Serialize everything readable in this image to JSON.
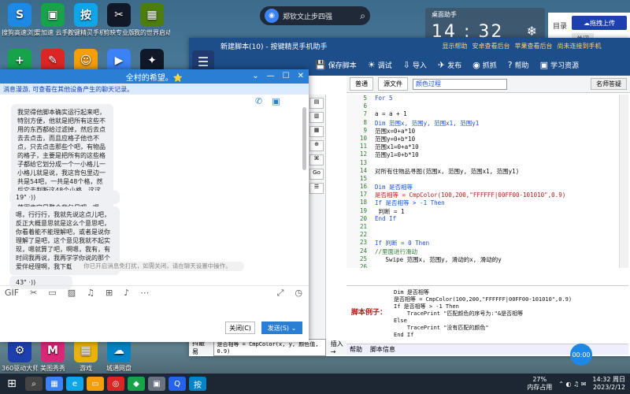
{
  "desktop": {
    "top_icons": [
      {
        "label": "搜狗高速浏览器",
        "icon": "sogou-icon",
        "color": "#1e88e5",
        "glyph": "S"
      },
      {
        "label": "爱加速 云手机",
        "icon": "cloudphone-icon",
        "color": "#16a34a",
        "glyph": "▣"
      },
      {
        "label": "按键精灵手机 7.0",
        "icon": "keyelf-icon",
        "color": "#0ea5e9",
        "glyph": "按"
      },
      {
        "label": "剪映专业版",
        "icon": "jianying-icon",
        "color": "#111827",
        "glyph": "✂"
      },
      {
        "label": "我的世界启动器",
        "icon": "minecraft-icon",
        "color": "#4d7c0f",
        "glyph": "▦"
      }
    ],
    "mid_icons": [
      {
        "icon": "plus-icon",
        "color": "#16a34a",
        "glyph": "+"
      },
      {
        "icon": "pen-icon",
        "color": "#dc2626",
        "glyph": "✎"
      },
      {
        "icon": "smiley-icon",
        "color": "#f59e0b",
        "glyph": "☺"
      },
      {
        "icon": "live-icon",
        "color": "#3b82f6",
        "glyph": "▶"
      },
      {
        "icon": "bulb-icon",
        "color": "#111827",
        "glyph": "✦"
      }
    ],
    "bottom_icons": [
      {
        "label": "360驱动大师",
        "icon": "driver-icon",
        "color": "#1e40af",
        "glyph": "⚙"
      },
      {
        "label": "美图秀秀",
        "icon": "meitu-icon",
        "color": "#db2777",
        "glyph": "M"
      },
      {
        "label": "游戏",
        "icon": "game-icon",
        "color": "#eab308",
        "glyph": "▦"
      },
      {
        "label": "城通网盘",
        "icon": "cloud-disk-icon",
        "color": "#0284c7",
        "glyph": "☁"
      }
    ]
  },
  "top_search": {
    "text": "郑钦文止步四强"
  },
  "clock_widget": {
    "label": "桌面助手",
    "time": "14 : 32"
  },
  "right_panel": {
    "catalog": "目录",
    "upload": "拖拽上传",
    "close": "关闭"
  },
  "editor": {
    "title": "新建脚本(10) - 按键精灵手机助手",
    "hint_items": [
      "显示帮助",
      "安卓查看后台",
      "苹果查看后台",
      "尚未连接到手机"
    ],
    "ribbon": [
      "保存脚本",
      "调试",
      "导入",
      "发布",
      "抓抓",
      "帮助",
      "学习资源"
    ],
    "subtabs": [
      "普通",
      "源文件"
    ],
    "combo": "颜色过程",
    "help_btn": "名师答疑",
    "code_lines": [
      {
        "n": "5",
        "t": "For 5",
        "c": "kw"
      },
      {
        "n": "6",
        "t": ""
      },
      {
        "n": "7",
        "t": "a = a + 1"
      },
      {
        "n": "8",
        "t": "Dim 范围x, 范围y, 范围x1, 范围y1",
        "c": "kw"
      },
      {
        "n": "9",
        "t": "范围x=0+a*10"
      },
      {
        "n": "10",
        "t": "范围y=0+b*10"
      },
      {
        "n": "11",
        "t": "范围x1=0+a*10"
      },
      {
        "n": "12",
        "t": "范围y1=0+b*10"
      },
      {
        "n": "13",
        "t": ""
      },
      {
        "n": "14",
        "t": "对所有住物品寻图(范围x, 范围y, 范围x1, 范围y1)"
      },
      {
        "n": "15",
        "t": ""
      },
      {
        "n": "16",
        "t": "Dim 是否相等",
        "c": "kw"
      },
      {
        "n": "17",
        "t": "是否相等 = CmpColor(100,200,\"FFFFFF|00FF00-101010\",0.9)",
        "c": "str"
      },
      {
        "n": "18",
        "t": "If 是否相等 > -1 Then",
        "c": "kw"
      },
      {
        "n": "19",
        "t": " 判断 = 1"
      },
      {
        "n": "20",
        "t": "End If",
        "c": "kw"
      },
      {
        "n": "21",
        "t": ""
      },
      {
        "n": "22",
        "t": ""
      },
      {
        "n": "23",
        "t": "If 判断 = 0 Then",
        "c": "kw"
      },
      {
        "n": "24",
        "t": "//里面进行滑动",
        "c": "cm"
      },
      {
        "n": "25",
        "t": "   Swipe 范围x, 范围y, 滑动的x, 滑动的y"
      },
      {
        "n": "26",
        "t": ""
      },
      {
        "n": "27",
        "t": "End If",
        "c": "kw"
      },
      {
        "n": "28",
        "t": ""
      },
      {
        "n": "29",
        "t": "Next",
        "c": "kw"
      },
      {
        "n": "30",
        "t": "Next",
        "c": "kw"
      }
    ],
    "example_label": "脚本例子：",
    "example_code": "Dim 是否相等\n是否相等 = CmpColor(100,200,\"FFFFFF|00FF00-101010\",0.9)\nIf 是否相等 > -1 Then\n    TracePrint \"匹配颜色的序号为:\"&是否相等\nElse\n    TracePrint \"没有匹配的颜色\"\nEnd If\n\n更新代码",
    "bottom_tabs": [
      "帮助",
      "脚本信息"
    ],
    "bottom_left_tab": "抖最易",
    "bottom_left_field": "是否相等 = CmpColor(x, y, 颜色值, 0.9)",
    "bottom_left_insert": "插入→",
    "side_props": [
      "颜色",
      "颜色",
      "颜色",
      "色",
      "颜色",
      "颜色"
    ],
    "dock_label": "搜索命令"
  },
  "chat": {
    "title": "全村的希望。⭐",
    "notice": "消息漫游, 可查看在其他设备产生的聊天记录。",
    "messages": [
      "我觉得他脚本确实运行起来吧，特别方便，他就是把所有这些不用的东西都给过滤掉，然后去点去去点击，而且应格子他也不点，只去点击那些个吧，有物品的格子，主要是把所有的这些格子都给它划分成一个一小格儿一小格儿就是说，我这背包里边一共是54吧，一共是48个格，然后它去判断这48个小格，这这一块，我想不明白，嗯，我用那范围肯定是整个背包是吧，嗯。",
      "嗯，行行行，我就先说这点儿吧，反正大概意思就是这么个意思吧，你看着能不能理解吧，或者是说你理解了是吧，这个意见我就不起实现，嗯就算了吧，啊嗯，我有，有时间我再说，我再学学你说的那个爱伴经理啊，我下载一个看看。"
    ],
    "voice_1": "19\" ·))",
    "voice_2": "43\" ·))",
    "system_msg": "你已开启消息免打扰，如需关闭，请在聊天设置中操作。",
    "close_btn": "关闭(C)",
    "send_btn": "发送(S)"
  },
  "taskbar": {
    "mem": "27%",
    "mem_label": "内存占用",
    "time": "14:32 周日",
    "date": "2023/2/12",
    "bubble": "00:00"
  }
}
